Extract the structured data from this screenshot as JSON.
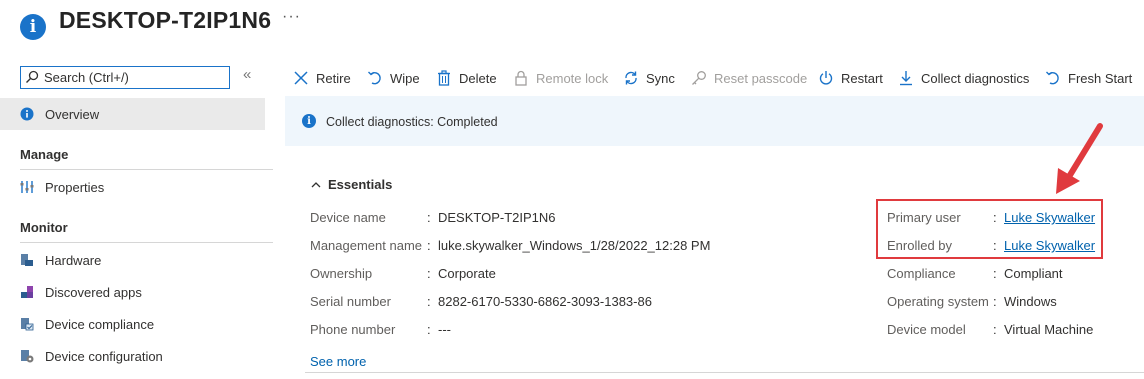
{
  "header": {
    "title": "DESKTOP-T2IP1N6",
    "more": "···"
  },
  "sidebar": {
    "search_placeholder": "Search (Ctrl+/)",
    "collapse": "«",
    "overview": "Overview",
    "sections": {
      "manage": "Manage",
      "monitor": "Monitor"
    },
    "manage_items": [
      {
        "label": "Properties",
        "icon": "properties-icon"
      }
    ],
    "monitor_items": [
      {
        "label": "Hardware",
        "icon": "hardware-icon"
      },
      {
        "label": "Discovered apps",
        "icon": "apps-icon"
      },
      {
        "label": "Device compliance",
        "icon": "compliance-icon"
      },
      {
        "label": "Device configuration",
        "icon": "configuration-icon"
      }
    ]
  },
  "toolbar": {
    "retire": "Retire",
    "wipe": "Wipe",
    "delete": "Delete",
    "remote_lock": "Remote lock",
    "sync": "Sync",
    "reset_passcode": "Reset passcode",
    "restart": "Restart",
    "collect_diagnostics": "Collect diagnostics",
    "fresh_start": "Fresh Start"
  },
  "notice": {
    "text": "Collect diagnostics: Completed"
  },
  "essentials": {
    "label": "Essentials",
    "left": [
      {
        "label": "Device name",
        "value": "DESKTOP-T2IP1N6"
      },
      {
        "label": "Management name",
        "value": "luke.skywalker_Windows_1/28/2022_12:28 PM"
      },
      {
        "label": "Ownership",
        "value": "Corporate"
      },
      {
        "label": "Serial number",
        "value": "8282-6170-5330-6862-3093-1383-86"
      },
      {
        "label": "Phone number",
        "value": "---"
      }
    ],
    "right": [
      {
        "label": "Primary user",
        "value": "Luke Skywalker"
      },
      {
        "label": "Enrolled by",
        "value": "Luke Skywalker"
      },
      {
        "label": "Compliance",
        "value": "Compliant"
      },
      {
        "label": "Operating system",
        "value": "Windows"
      },
      {
        "label": "Device model",
        "value": "Virtual Machine"
      }
    ],
    "colon": ":",
    "see_more": "See more"
  },
  "colors": {
    "accent": "#1a73c9",
    "link": "#0062ad",
    "annotation": "#e03a3e",
    "notice_bg": "#eff6fc"
  }
}
